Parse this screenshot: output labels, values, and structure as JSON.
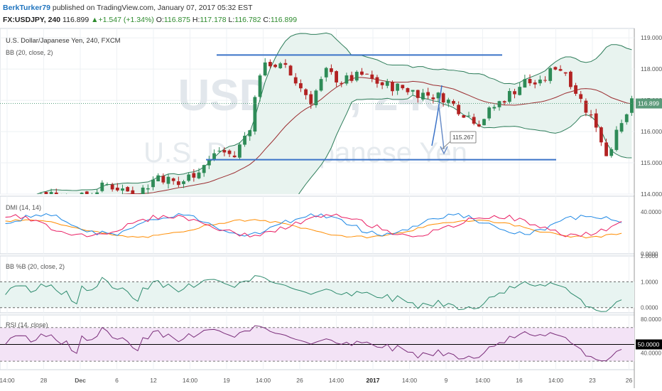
{
  "header": {
    "author": "BerkTurker79",
    "published_text": "published on TradingView.com, January 07, 2017 05:32 EST",
    "symbol": "FX:USDJPY, 240",
    "last": "116.899",
    "change": "▲+1.547 (+1.34%)",
    "o_label": "O:",
    "o_value": "116.875",
    "h_label": "H:",
    "h_value": "117.178",
    "l_label": "L:",
    "l_value": "116.782",
    "c_label": "C:",
    "c_value": "116.899"
  },
  "watermark": {
    "symbol": "USDJPY, 240",
    "description": "U.S. Dollar/Japanese Yen"
  },
  "chart_data": [
    {
      "type": "candlestick",
      "title": "U.S. Dollar/Japanese Yen, 240, FXCM",
      "indicator_label": "BB (20, close, 2)",
      "ylim": [
        114.0,
        119.3
      ],
      "y_ticks": [
        "119.000",
        "118.000",
        "117.000",
        "116.000",
        "115.000",
        "114.000"
      ],
      "current_price_label": "116.899",
      "annotation": "115.267",
      "horizontal_levels": [
        118.45,
        115.1
      ],
      "price_path": [
        [
          0,
          113.6
        ],
        [
          8,
          114.1
        ],
        [
          14,
          113.8
        ],
        [
          20,
          114.3
        ],
        [
          26,
          114.0
        ],
        [
          30,
          114.6
        ],
        [
          34,
          114.3
        ],
        [
          38,
          114.8
        ],
        [
          42,
          115.4
        ],
        [
          45,
          115.2
        ],
        [
          48,
          116.2
        ],
        [
          50,
          117.9
        ],
        [
          52,
          118.2
        ],
        [
          55,
          118.0
        ],
        [
          58,
          117.4
        ],
        [
          60,
          117.0
        ],
        [
          63,
          117.9
        ],
        [
          66,
          117.6
        ],
        [
          70,
          117.8
        ],
        [
          74,
          117.5
        ],
        [
          78,
          117.4
        ],
        [
          82,
          117.2
        ],
        [
          86,
          117.1
        ],
        [
          90,
          116.6
        ],
        [
          93,
          116.3
        ],
        [
          96,
          116.8
        ],
        [
          99,
          117.2
        ],
        [
          102,
          117.6
        ],
        [
          105,
          117.5
        ],
        [
          108,
          118.1
        ],
        [
          110,
          117.9
        ],
        [
          113,
          117.0
        ],
        [
          116,
          116.2
        ],
        [
          118,
          115.3
        ],
        [
          121,
          116.2
        ],
        [
          123,
          116.9
        ]
      ],
      "series": [
        {
          "name": "DMI (14, 14)",
          "ylim": [
            0,
            55
          ],
          "y_ticks": [
            "40.0000",
            "0.0000"
          ]
        },
        {
          "name": "BB %B (20, close, 2)",
          "ylim": [
            -0.2,
            2.0
          ],
          "y_ticks": [
            "2.0000",
            "1.0000",
            "0.0000"
          ]
        },
        {
          "name": "RSI (14, close)",
          "ylim": [
            20,
            85
          ],
          "y_ticks": [
            "80.0000",
            "50.0000",
            "40.0000"
          ],
          "current_label": "50.0000"
        }
      ],
      "x_tick_labels": [
        "14:00",
        "28",
        "Dec",
        "6",
        "12",
        "14:00",
        "19",
        "14:00",
        "26",
        "14:00",
        "2017",
        "14:00",
        "9",
        "14:00",
        "16",
        "14:00",
        "23",
        "26"
      ],
      "colors": {
        "up": "#2e8b57",
        "down": "#b22222",
        "bb_fill": "#e8f3ef",
        "bb_line": "#2e7d5a",
        "basis": "#9b2d30",
        "level": "#3b73c8",
        "plus_di": "#1e88e5",
        "minus_di": "#e91e63",
        "adx": "#ff8c00",
        "pctb": "#2e8b6e",
        "rsi": "#7b2f7b",
        "rsi_band": "#f3e3f6"
      }
    }
  ]
}
